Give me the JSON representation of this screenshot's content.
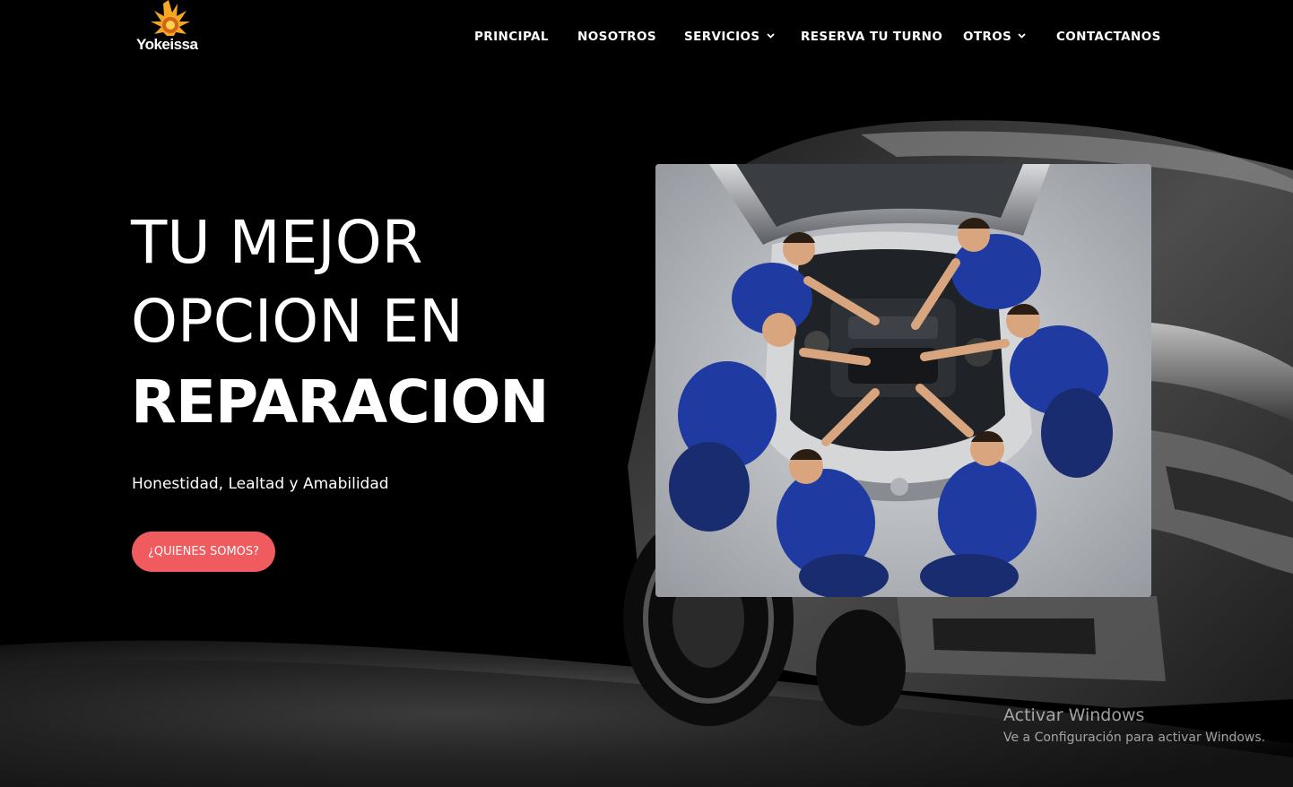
{
  "brand": {
    "name": "Yokeissa",
    "accent": "#f5a623"
  },
  "nav": {
    "items": [
      {
        "label": "PRINCIPAL",
        "has_dropdown": false
      },
      {
        "label": "NOSOTROS",
        "has_dropdown": false
      },
      {
        "label": "SERVICIOS",
        "has_dropdown": true,
        "icon": "chevron-down-icon"
      },
      {
        "label": "RESERVA TU TURNO",
        "has_dropdown": false
      },
      {
        "label": "OTROS",
        "has_dropdown": true,
        "icon": "chevron-down-icon"
      },
      {
        "label": "CONTACTANOS",
        "has_dropdown": false
      }
    ]
  },
  "hero": {
    "line1": "TU MEJOR",
    "line2": "OPCION EN",
    "line3": "REPARACION",
    "tagline": "Honestidad, Lealtad y Amabilidad",
    "cta_label": "¿QUIENES SOMOS?",
    "cta_color": "#ef5b5f"
  },
  "photo": {
    "subject": "mechanics-team-around-engine-image"
  },
  "os_watermark": {
    "title": "Activar Windows",
    "subtitle": "Ve a Configuración para activar Windows."
  }
}
